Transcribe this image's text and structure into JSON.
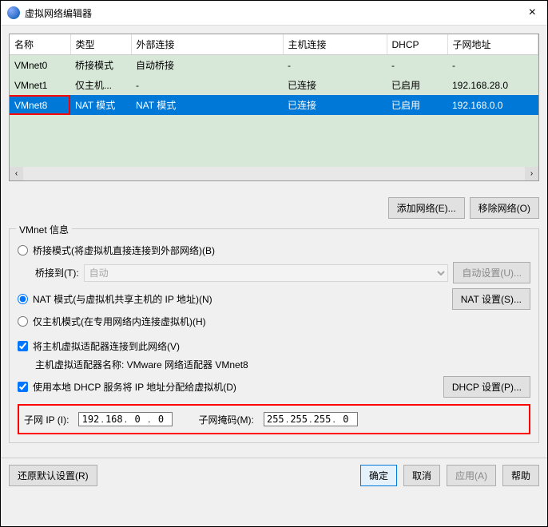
{
  "titlebar": {
    "title": "虚拟网络编辑器",
    "close": "×"
  },
  "table": {
    "headers": [
      "名称",
      "类型",
      "外部连接",
      "主机连接",
      "DHCP",
      "子网地址"
    ],
    "rows": [
      {
        "name": "VMnet0",
        "type": "桥接模式",
        "ext": "自动桥接",
        "host": "-",
        "dhcp": "-",
        "subnet": "-",
        "selected": false,
        "marked": false
      },
      {
        "name": "VMnet1",
        "type": "仅主机...",
        "ext": "-",
        "host": "已连接",
        "dhcp": "已启用",
        "subnet": "192.168.28.0",
        "selected": false,
        "marked": false
      },
      {
        "name": "VMnet8",
        "type": "NAT 模式",
        "ext": "NAT 模式",
        "host": "已连接",
        "dhcp": "已启用",
        "subnet": "192.168.0.0",
        "selected": true,
        "marked": true
      }
    ]
  },
  "hscroll": {
    "left": "‹",
    "right": "›"
  },
  "topbtns": {
    "add": "添加网络(E)...",
    "remove": "移除网络(O)"
  },
  "fieldset": {
    "legend": "VMnet 信息",
    "bridge_label": "桥接模式(将虚拟机直接连接到外部网络)(B)",
    "bridge_to_label": "桥接到(T):",
    "bridge_combo": "自动",
    "auto_btn": "自动设置(U)...",
    "nat_label": "NAT 模式(与虚拟机共享主机的 IP 地址)(N)",
    "nat_btn": "NAT 设置(S)...",
    "hostonly_label": "仅主机模式(在专用网络内连接虚拟机)(H)",
    "host_adapter_label": "将主机虚拟适配器连接到此网络(V)",
    "host_adapter_name_label": "主机虚拟适配器名称: VMware 网络适配器 VMnet8",
    "dhcp_label": "使用本地 DHCP 服务将 IP 地址分配给虚拟机(D)",
    "dhcp_btn": "DHCP 设置(P)...",
    "subnet_ip_label": "子网 IP (I):",
    "subnet_ip": [
      "192",
      "168",
      "0",
      "0"
    ],
    "subnet_mask_label": "子网掩码(M):",
    "subnet_mask": [
      "255",
      "255",
      "255",
      "0"
    ]
  },
  "bottom": {
    "restore": "还原默认设置(R)",
    "ok": "确定",
    "cancel": "取消",
    "apply": "应用(A)",
    "help": "帮助"
  }
}
